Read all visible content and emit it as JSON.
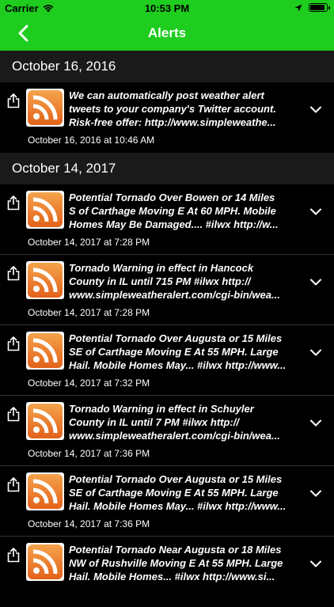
{
  "status_bar": {
    "carrier": "Carrier",
    "time": "10:53 PM"
  },
  "nav": {
    "title": "Alerts",
    "back_icon": "chevron-left-icon"
  },
  "colors": {
    "nav_green": "#1ecd1e",
    "background": "#000000",
    "rss_orange": "#e2621a"
  },
  "sections": [
    {
      "header": "October 16, 2016",
      "alerts": [
        {
          "text": "We can automatically post weather alert\ntweets to your company's Twitter account.\nRisk-free offer:  http://www.simpleweathe...",
          "date": "October 16, 2016 at 10:46 AM"
        }
      ]
    },
    {
      "header": "October 14, 2017",
      "alerts": [
        {
          "text": "Potential Tornado Over Bowen or 14 Miles\nS of Carthage Moving E At 60 MPH. Mobile\nHomes May Be Damaged.... #ilwx  http://w...",
          "date": "October 14, 2017 at 7:28 PM"
        },
        {
          "text": "Tornado Warning in effect in Hancock\nCounty in IL until 715 PM #ilwx  http://\nwww.simpleweatheralert.com/cgi-bin/wea...",
          "date": "October 14, 2017 at 7:28 PM"
        },
        {
          "text": "Potential Tornado Over Augusta or 15 Miles\nSE of Carthage Moving E At 55 MPH. Large\nHail. Mobile Homes May... #ilwx  http://www...",
          "date": "October 14, 2017 at 7:32 PM"
        },
        {
          "text": "Tornado Warning in effect in Schuyler\nCounty in IL until 7 PM #ilwx  http://\nwww.simpleweatheralert.com/cgi-bin/wea...",
          "date": "October 14, 2017 at 7:36 PM"
        },
        {
          "text": "Potential Tornado Over Augusta or 15 Miles\nSE of Carthage Moving E At 55 MPH. Large\nHail. Mobile Homes May... #ilwx  http://www...",
          "date": "October 14, 2017 at 7:36 PM"
        },
        {
          "text": "Potential Tornado Near Augusta or 18 Miles\nNW of Rushville Moving E At 55 MPH. Large\nHail. Mobile Homes... #ilwx  http://www.si...",
          "date": ""
        }
      ]
    }
  ]
}
